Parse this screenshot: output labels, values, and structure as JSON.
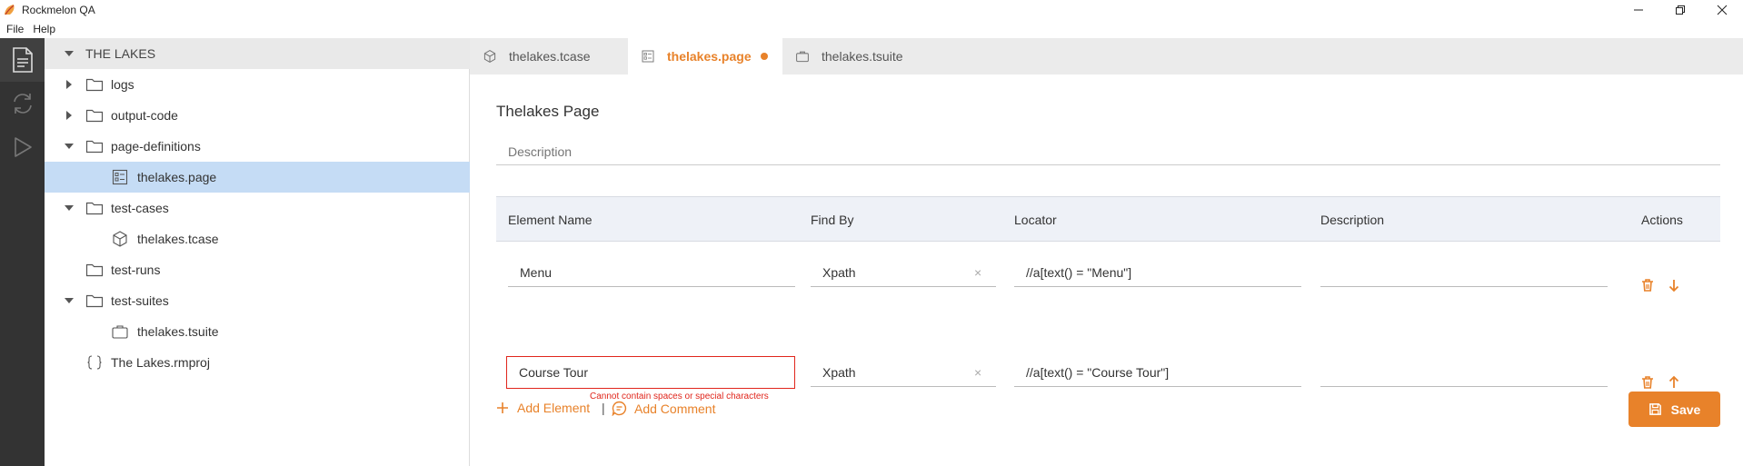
{
  "window": {
    "title": "Rockmelon QA"
  },
  "menu": [
    "File",
    "Help"
  ],
  "explorer": {
    "root": "THE LAKES",
    "items": [
      {
        "label": "logs"
      },
      {
        "label": "output-code"
      },
      {
        "label": "page-definitions"
      },
      {
        "label": "thelakes.page"
      },
      {
        "label": "test-cases"
      },
      {
        "label": "thelakes.tcase"
      },
      {
        "label": "test-runs"
      },
      {
        "label": "test-suites"
      },
      {
        "label": "thelakes.tsuite"
      },
      {
        "label": "The Lakes.rmproj"
      }
    ]
  },
  "tabs": [
    {
      "label": "thelakes.tcase"
    },
    {
      "label": "thelakes.page"
    },
    {
      "label": "thelakes.tsuite"
    }
  ],
  "page": {
    "title": "Thelakes Page",
    "description_placeholder": "Description"
  },
  "table": {
    "headers": {
      "element_name": "Element Name",
      "find_by": "Find By",
      "locator": "Locator",
      "description": "Description",
      "actions": "Actions"
    },
    "rows": [
      {
        "element_name": "Menu",
        "find_by": "Xpath",
        "locator": "//a[text() = \"Menu\"]",
        "description": ""
      },
      {
        "element_name": "Course Tour",
        "find_by": "Xpath",
        "locator": "//a[text() = \"Course Tour\"]",
        "description": "",
        "error": "Cannot contain spaces or special characters"
      }
    ]
  },
  "footer": {
    "add_element": "Add Element",
    "separator": "|",
    "add_comment": "Add Comment",
    "save": "Save"
  },
  "colors": {
    "accent": "#e8822a",
    "error": "#e0261c",
    "selected": "#c5dcf5",
    "activitybar": "#333333"
  },
  "clear_glyph": "×"
}
